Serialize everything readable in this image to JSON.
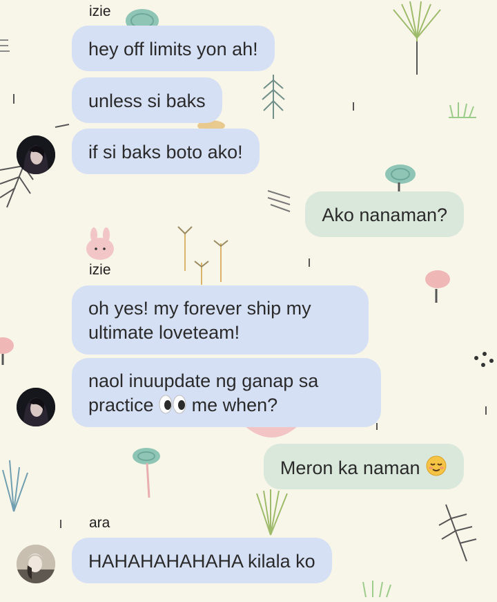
{
  "chat": {
    "messages": [
      {
        "sender": "izie",
        "text": "hey off limits yon ah!"
      },
      {
        "text": "unless si baks"
      },
      {
        "text": "if si baks boto ako!"
      },
      {
        "text": "Ako nanaman?"
      },
      {
        "sender": "izie",
        "line1": "oh yes! my forever ship my",
        "line2": "ultimate loveteam!"
      },
      {
        "line1": "naol inuupdate ng ganap sa",
        "line2_before": "practice",
        "line2_emoji": "eyes-emoji",
        "line2_after": "me when?"
      },
      {
        "text": "Meron ka naman",
        "emoji": "relieved-face-emoji"
      },
      {
        "sender": "ara",
        "text": "HAHAHAHAHAHA kilala ko"
      }
    ]
  },
  "colors": {
    "background": "#f8f5e9",
    "incoming_bubble": "#d6e0f5",
    "outgoing_bubble": "#dae8dc",
    "text": "#2a2a2a"
  }
}
